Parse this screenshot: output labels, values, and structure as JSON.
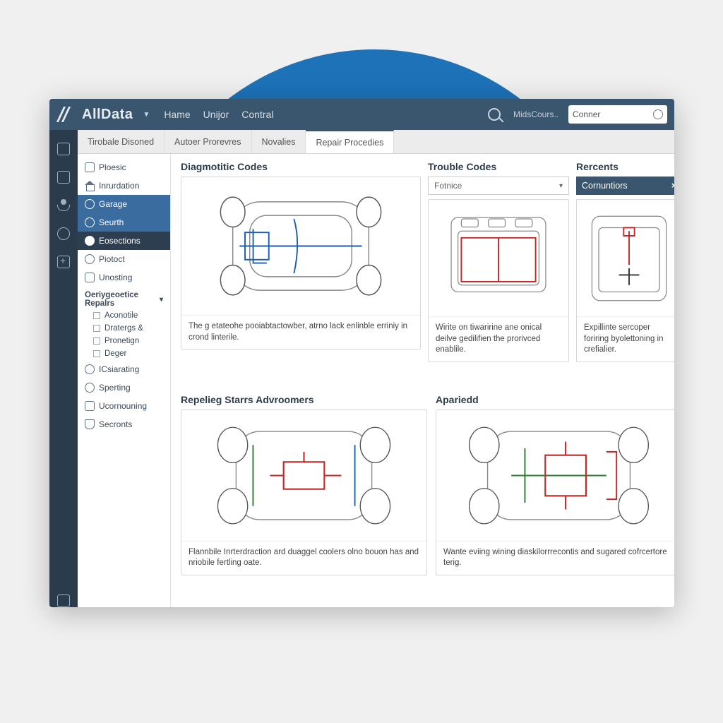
{
  "brand": "AllData",
  "topnav": {
    "a": "Hame",
    "b": "Unijor",
    "c": "Contral"
  },
  "topbar": {
    "hint": "MidsCours..",
    "search_ph": "Conner"
  },
  "subtabs": {
    "t0": "Tirobale Disoned",
    "t1": "Autoer Prorevres",
    "t2": "Novalies",
    "t3": "Repair Procedies"
  },
  "side": {
    "s0": "Ploesic",
    "s1": "Inrurdation",
    "s2": "Garage",
    "s3": "Seurth",
    "s4": "Eosections",
    "s5": "Piotoct",
    "s6": "Unosting",
    "grp": "Oeriygeoetice Repalrs",
    "c0": "Aconotile",
    "c1": "Dratergs &",
    "c2": "Pronetign",
    "c3": "Deger",
    "s7": "ICsiarating",
    "s8": "Sperting",
    "s9": "Ucornouning",
    "s10": "Secronts"
  },
  "sections": {
    "diag": "Diagmotitic Codes",
    "diag_cap": "The g etateohe pooiabtactowber, atrno lack enlinble erriniy in crond linterile.",
    "trouble": "Trouble Codes",
    "trouble_dd": "Fotnice",
    "trouble_cap": "Wirite on tiwaririne ane onical deilve gedilifien the prorivced enablile.",
    "recents": "Rercents",
    "recents_hdr": "Cornuntiors",
    "recents_cap": "Expillinte sercoper foriring byolettoning in crefialier.",
    "rep": "Repelieg Starrs Advroomers",
    "rep_cap": "Flannbile Inrterdraction ard duaggel coolers olno bouon has and nriobile fertling oate.",
    "app": "Apariedd",
    "app_cap": "Wante eviing wining diaskilorrrecontis and sugared cofrcertore terig."
  }
}
